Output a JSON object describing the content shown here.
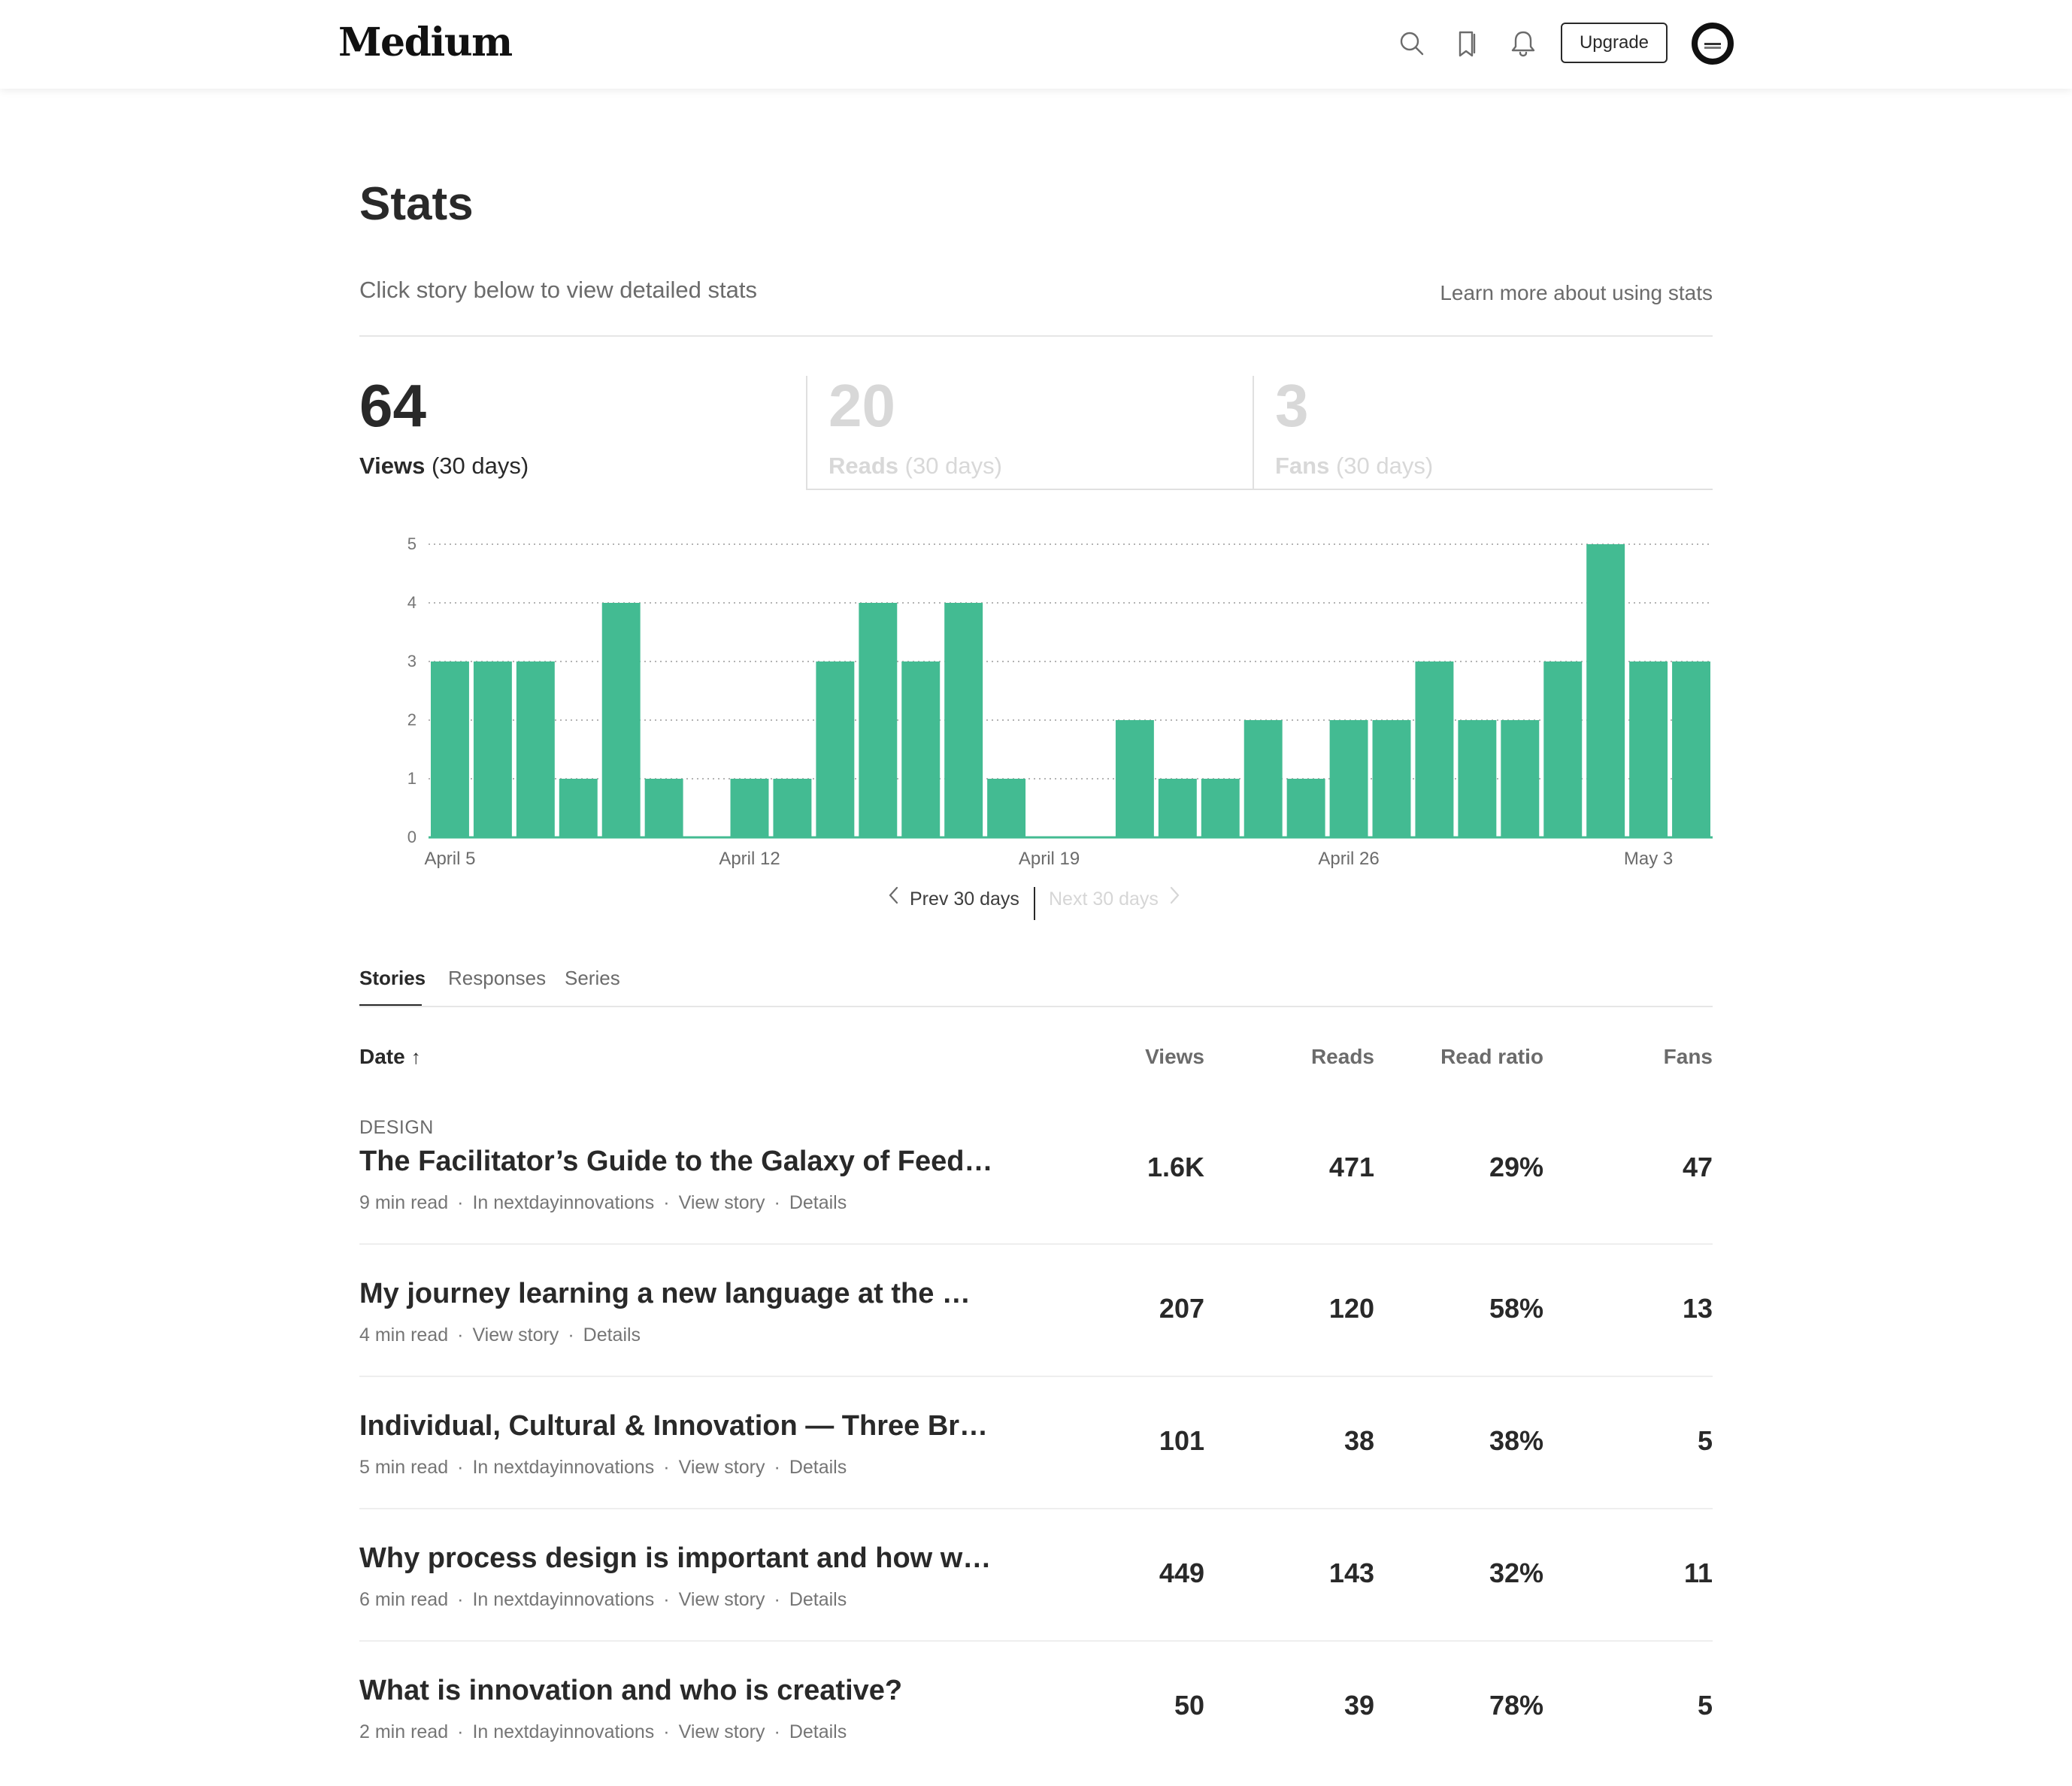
{
  "header": {
    "logo": "Medium",
    "upgrade_label": "Upgrade",
    "icons": [
      "search-icon",
      "bookmark-icon",
      "bell-icon"
    ]
  },
  "page": {
    "title": "Stats",
    "subtitle": "Click story below to view detailed stats",
    "learn_more": "Learn more about using stats"
  },
  "summary": [
    {
      "value": "64",
      "label": "Views",
      "period": "(30 days)",
      "active": true
    },
    {
      "value": "20",
      "label": "Reads",
      "period": "(30 days)",
      "active": false
    },
    {
      "value": "3",
      "label": "Fans",
      "period": "(30 days)",
      "active": false
    }
  ],
  "chart_data": {
    "type": "bar",
    "series": [
      {
        "values": [
          3,
          3,
          3,
          1,
          4,
          1,
          0,
          1,
          1,
          3,
          4,
          3,
          4,
          1,
          0,
          0,
          2,
          1,
          1,
          2,
          1,
          2,
          2,
          3,
          2,
          2,
          3,
          5,
          3,
          3
        ]
      }
    ],
    "x_tick_labels": [
      "April 5",
      "April 12",
      "April 19",
      "April 26",
      "May 3"
    ],
    "y_ticks": [
      0,
      1,
      2,
      3,
      4,
      5
    ],
    "ylim": [
      0,
      5
    ],
    "grid": "dotted horizontal",
    "bar_color": "#43bb92"
  },
  "pager": {
    "prev": "Prev 30 days",
    "next": "Next 30 days"
  },
  "section_tabs": [
    "Stories",
    "Responses",
    "Series"
  ],
  "table": {
    "headers": {
      "date": "Date",
      "views": "Views",
      "reads": "Reads",
      "ratio": "Read ratio",
      "fans": "Fans"
    },
    "rows": [
      {
        "category": "DESIGN",
        "title": "The Facilitator’s Guide to the Galaxy of Feed…",
        "read_time": "9 min read",
        "publication": "In nextdayinnovations",
        "view_story": "View story",
        "details": "Details",
        "views": "1.6K",
        "reads": "471",
        "ratio": "29%",
        "fans": "47"
      },
      {
        "category": "",
        "title": "My journey learning a new language at the …",
        "read_time": "4 min read",
        "publication": "",
        "view_story": "View story",
        "details": "Details",
        "views": "207",
        "reads": "120",
        "ratio": "58%",
        "fans": "13"
      },
      {
        "category": "",
        "title": "Individual, Cultural & Innovation — Three Br…",
        "read_time": "5 min read",
        "publication": "In nextdayinnovations",
        "view_story": "View story",
        "details": "Details",
        "views": "101",
        "reads": "38",
        "ratio": "38%",
        "fans": "5"
      },
      {
        "category": "",
        "title": "Why process design is important and how w…",
        "read_time": "6 min read",
        "publication": "In nextdayinnovations",
        "view_story": "View story",
        "details": "Details",
        "views": "449",
        "reads": "143",
        "ratio": "32%",
        "fans": "11"
      },
      {
        "category": "",
        "title": "What is innovation and who is creative?",
        "read_time": "2 min read",
        "publication": "In nextdayinnovations",
        "view_story": "View story",
        "details": "Details",
        "views": "50",
        "reads": "39",
        "ratio": "78%",
        "fans": "5"
      }
    ]
  }
}
